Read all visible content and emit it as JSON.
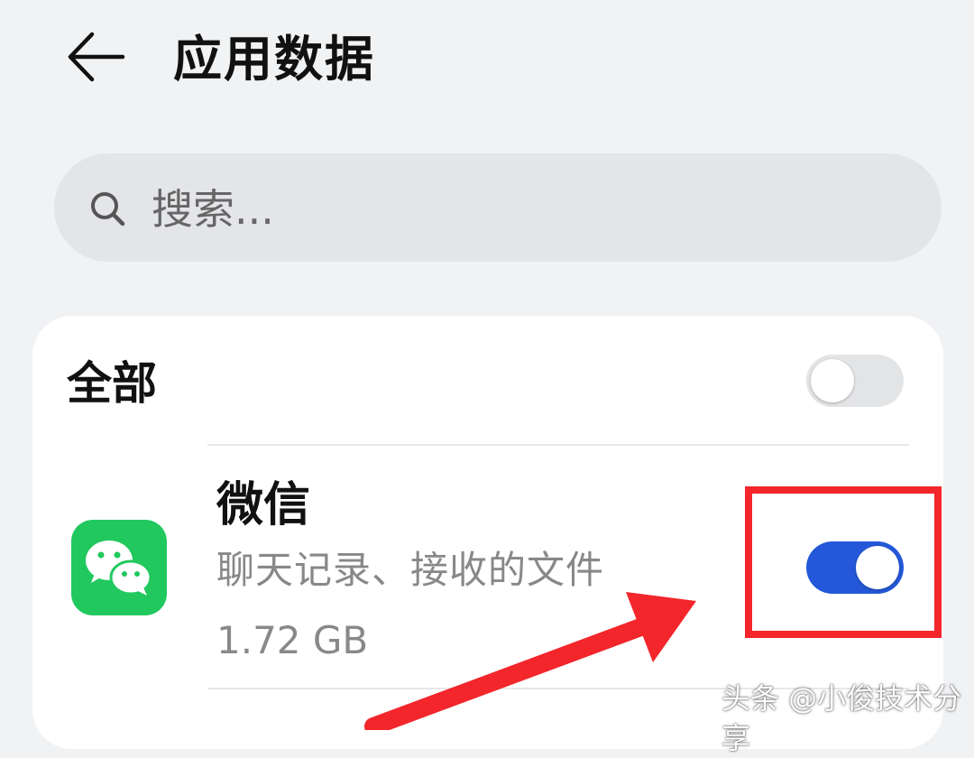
{
  "header": {
    "title": "应用数据",
    "back_icon": "arrow-left-icon"
  },
  "search": {
    "placeholder": "搜索...",
    "icon": "search-icon"
  },
  "list": {
    "all_label": "全部",
    "all_toggle_state": "off",
    "apps": [
      {
        "name": "微信",
        "description": "聊天记录、接收的文件",
        "size": "1.72 GB",
        "icon": "wechat-icon",
        "toggle_state": "on"
      }
    ]
  },
  "annotation": {
    "highlight_color": "#f2262b",
    "arrow_icon": "red-arrow-icon"
  },
  "watermark": "头条 @小俊技术分享",
  "colors": {
    "accent": "#2458d8",
    "wechat_green": "#21c85e",
    "background": "#f1f2f4"
  }
}
